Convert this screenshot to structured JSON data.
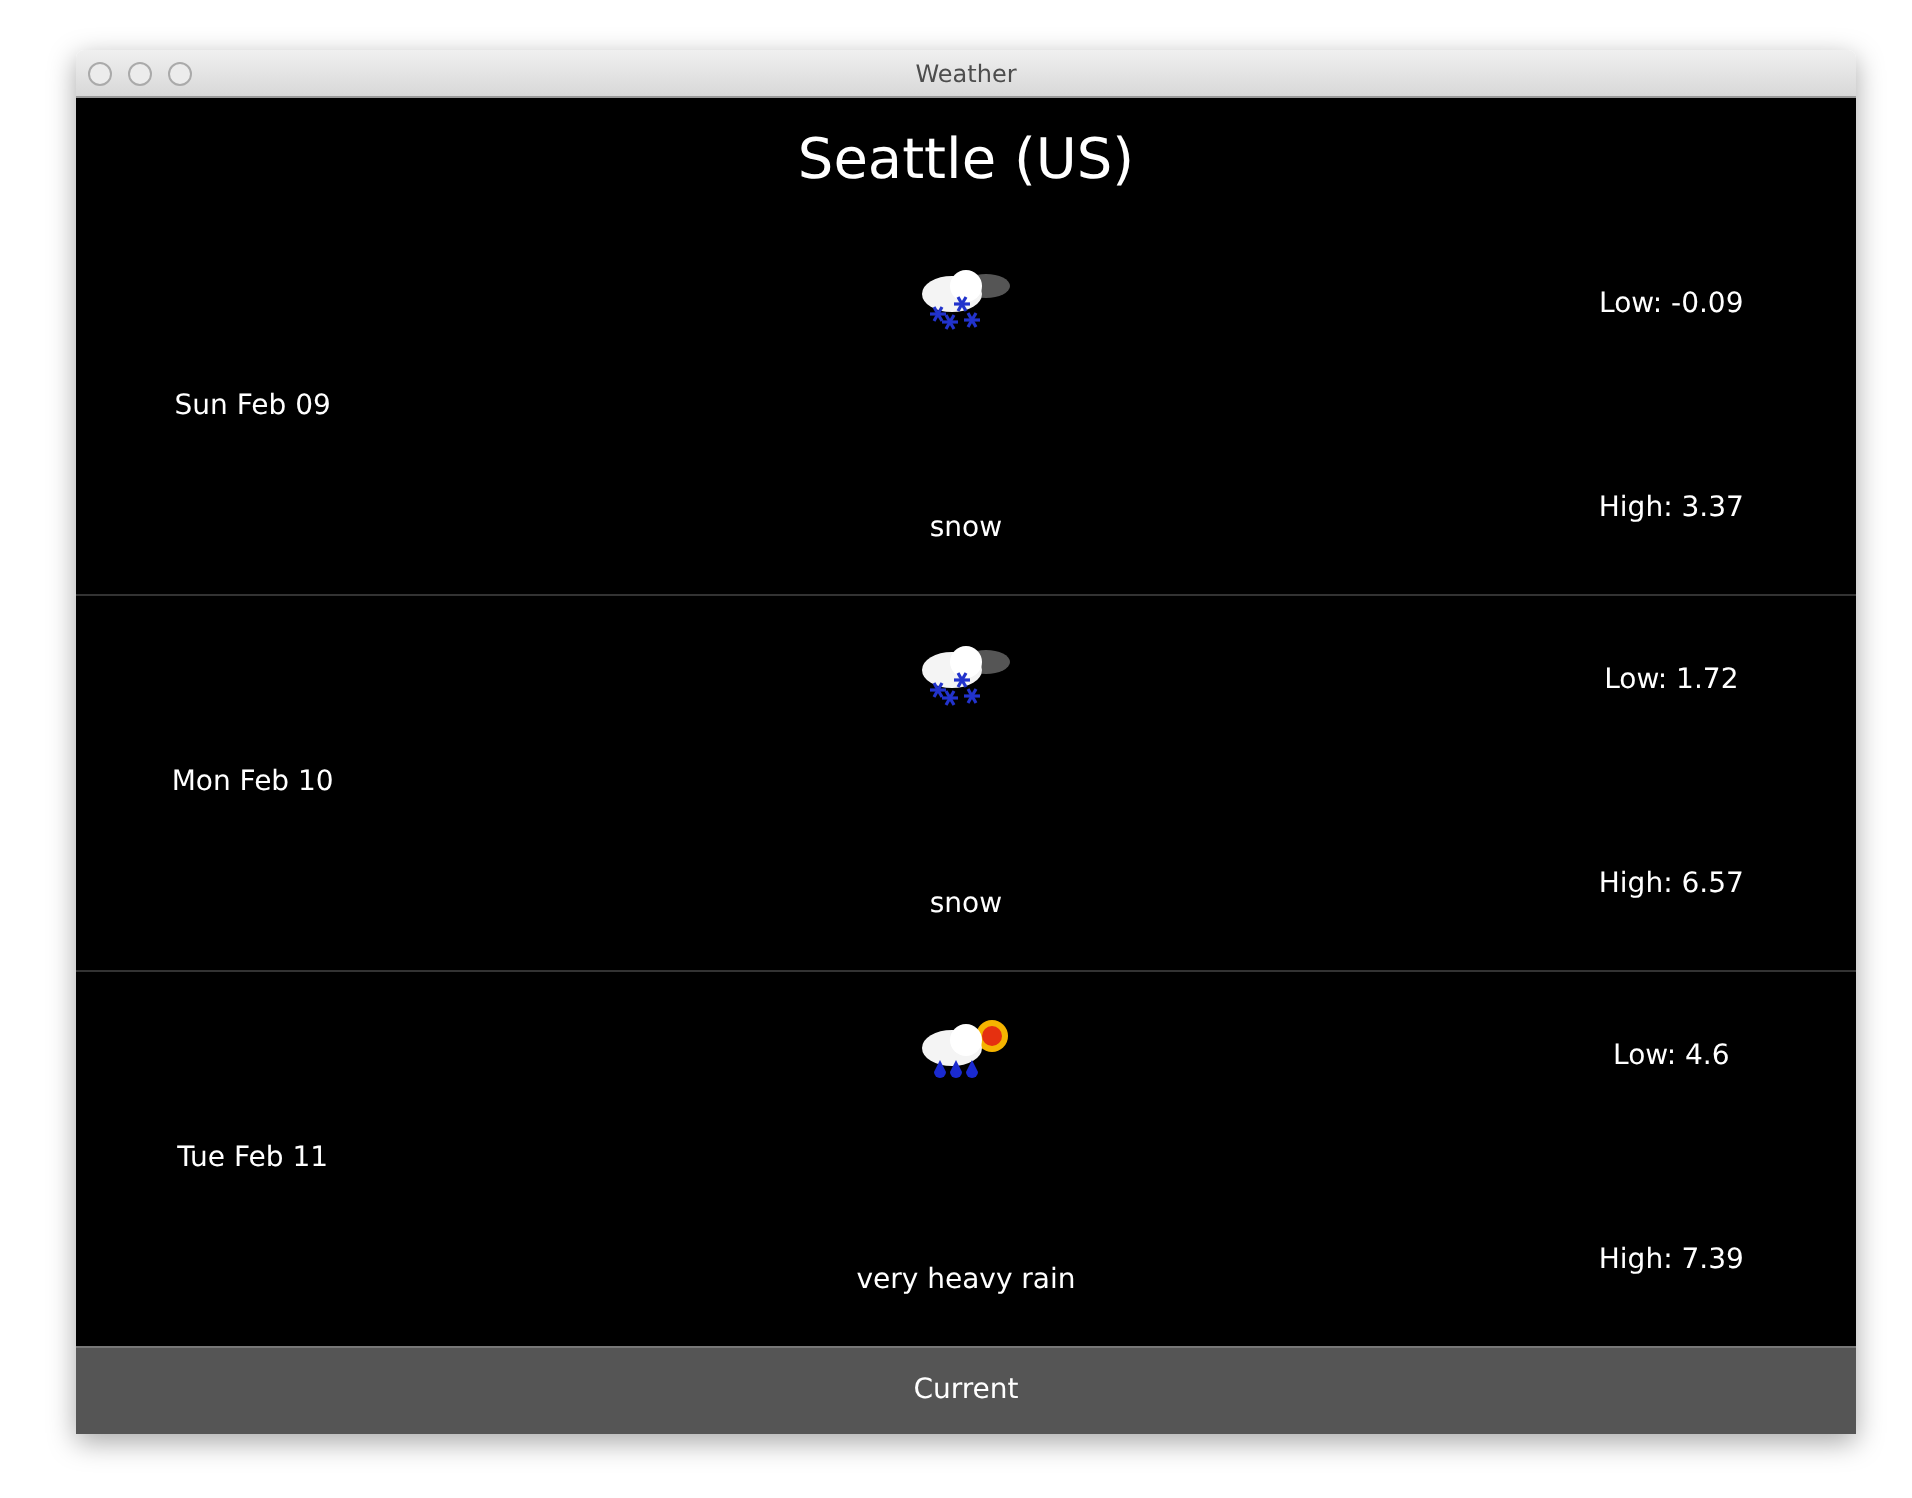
{
  "window": {
    "title": "Weather"
  },
  "city": "Seattle (US)",
  "days": [
    {
      "date": "Sun Feb 09",
      "kind": "snow",
      "condition": "snow",
      "low": "Low: -0.09",
      "high": "High: 3.37"
    },
    {
      "date": "Mon Feb 10",
      "kind": "snow",
      "condition": "snow",
      "low": "Low: 1.72",
      "high": "High: 6.57"
    },
    {
      "date": "Tue Feb 11",
      "kind": "rain_sun",
      "condition": "very heavy rain",
      "low": "Low: 4.6",
      "high": "High: 7.39"
    }
  ],
  "button": "Current"
}
